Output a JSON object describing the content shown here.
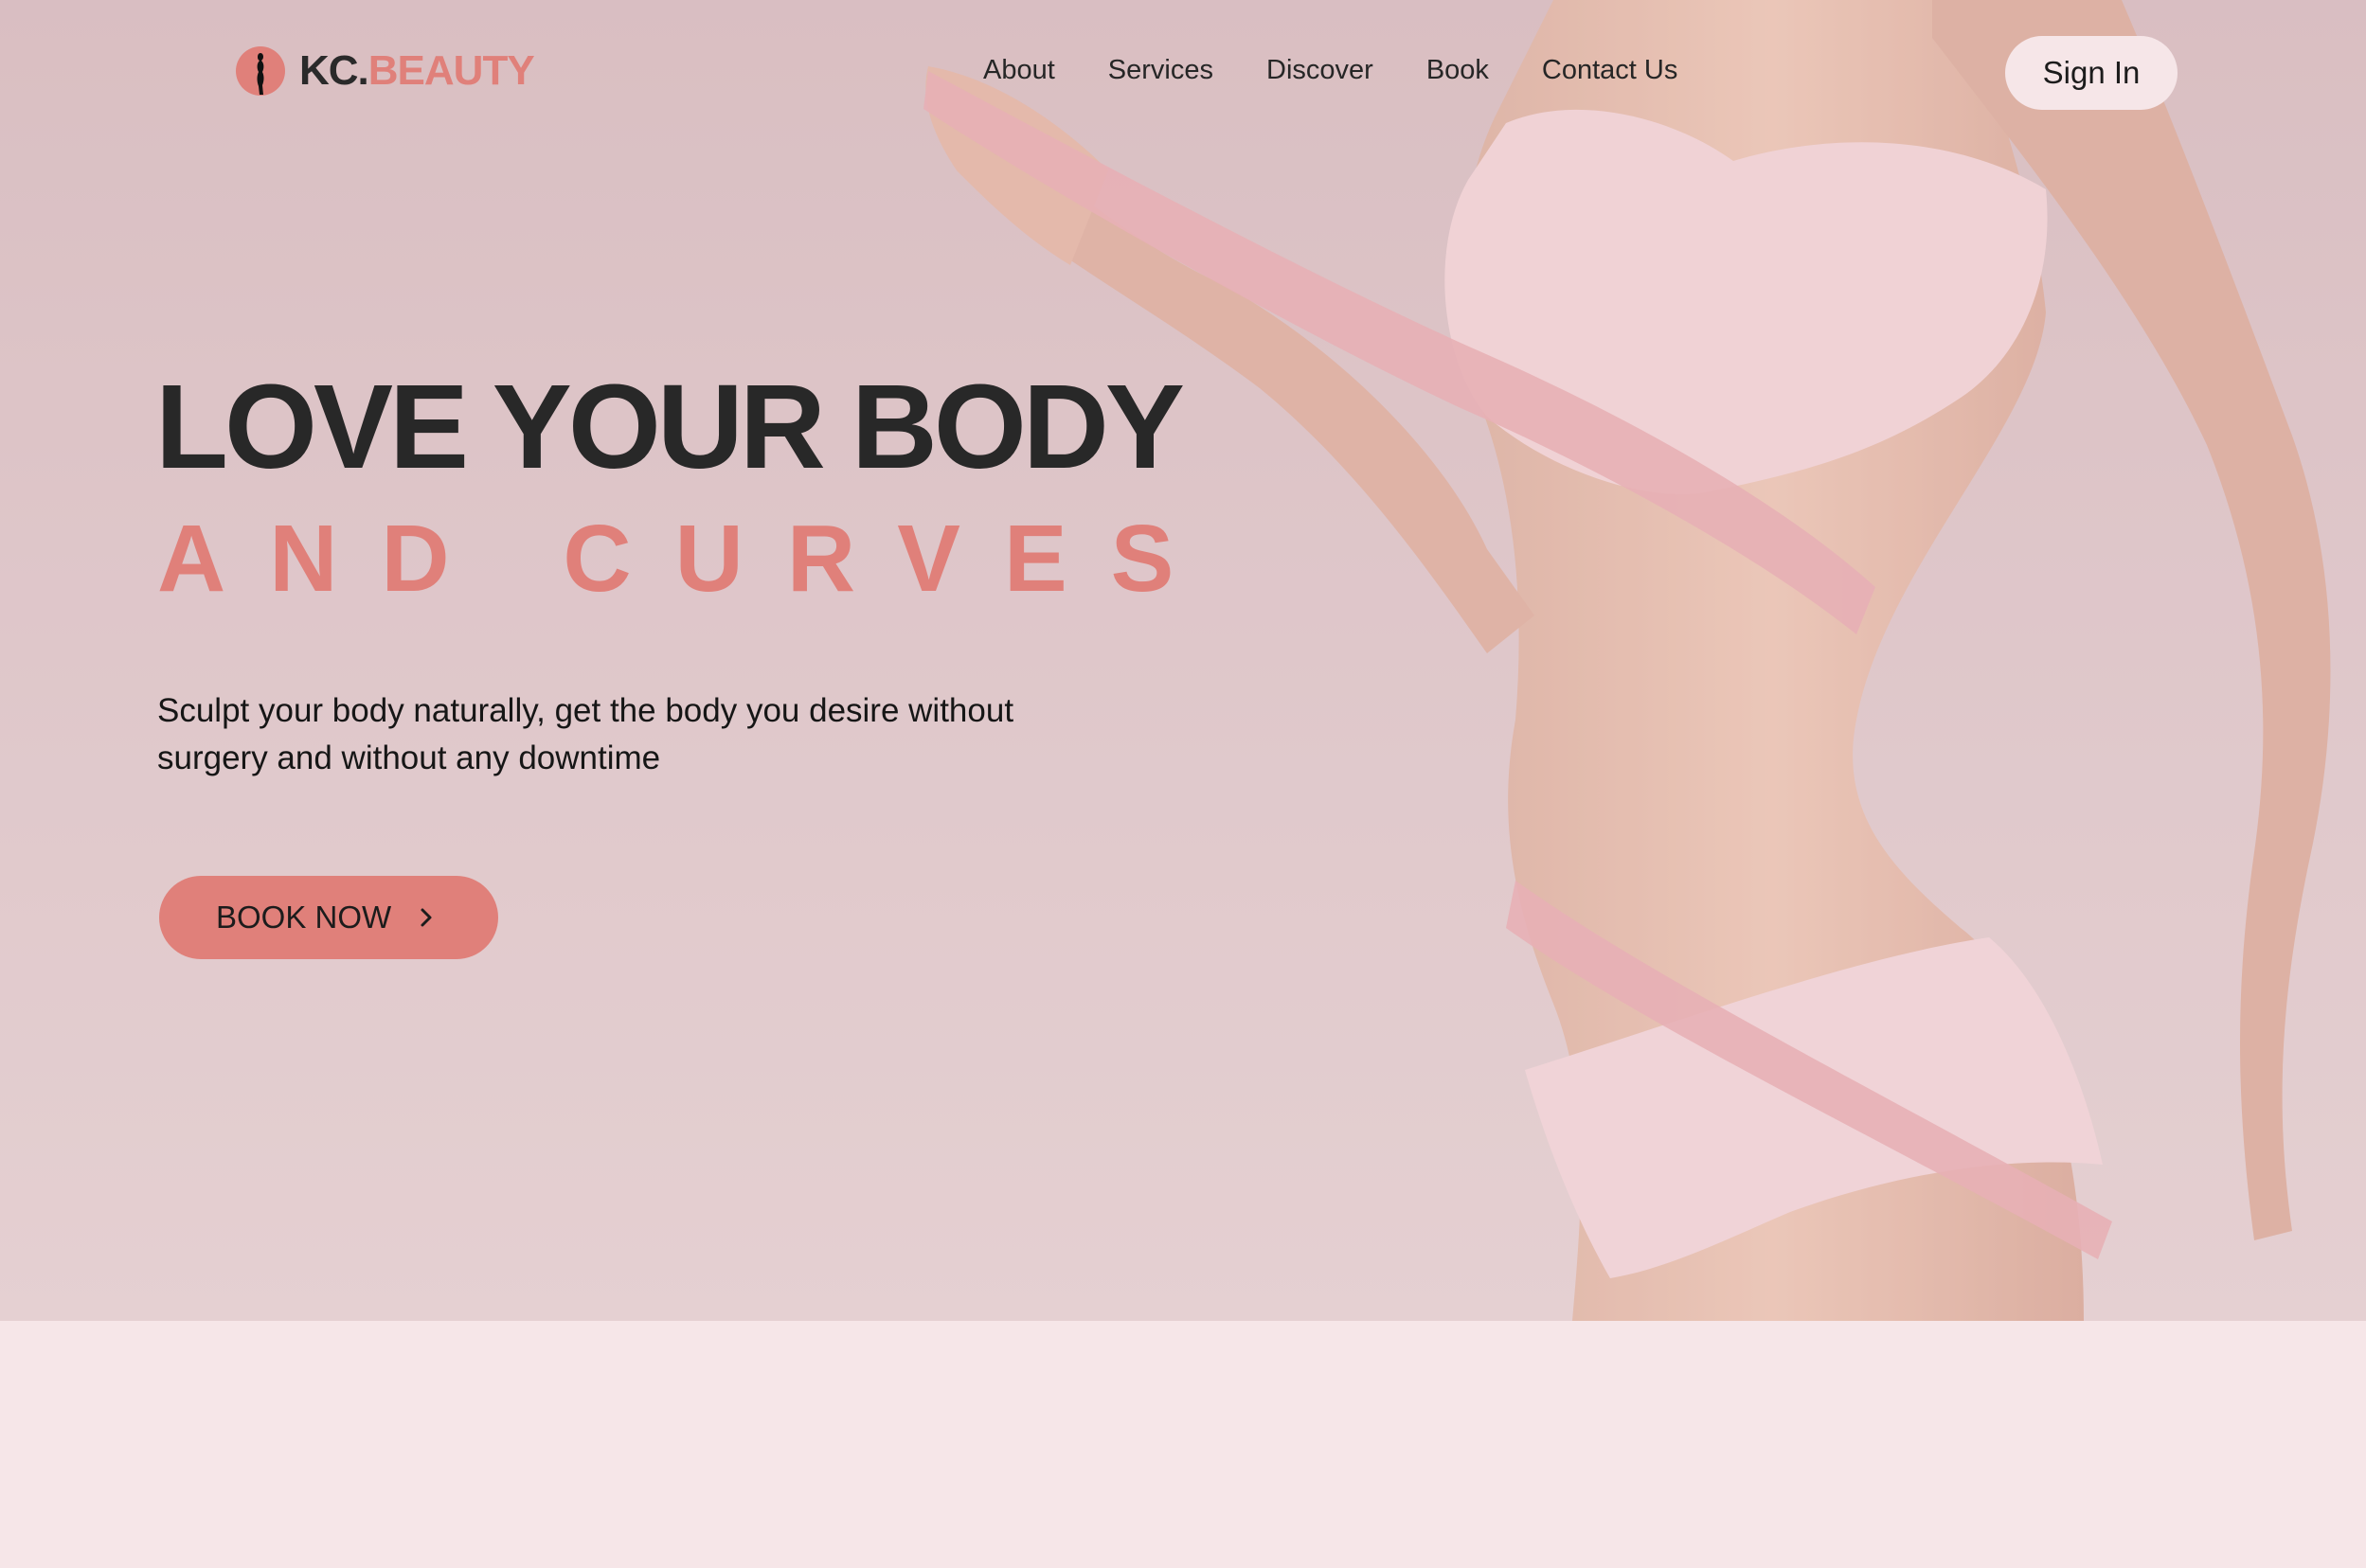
{
  "header": {
    "logo": {
      "prefix": "KC.",
      "suffix": "BEAUTY"
    },
    "nav": [
      "About",
      "Services",
      "Discover",
      "Book",
      "Contact Us"
    ],
    "sign_in_label": "Sign In"
  },
  "hero": {
    "headline_line1": "LOVE YOUR BODY",
    "headline_line2": "AND CURVES",
    "subtitle": "Sculpt your body naturally, get the body you desire without surgery and without any downtime",
    "cta_label": "BOOK NOW",
    "cta_icon": "chevron-right-icon",
    "image": "woman-with-measuring-tape-photo"
  },
  "colors": {
    "accent": "#e0807a",
    "hero_background": "#d8bfc2",
    "lower_background": "#f6e6e8",
    "heading": "#282828"
  }
}
